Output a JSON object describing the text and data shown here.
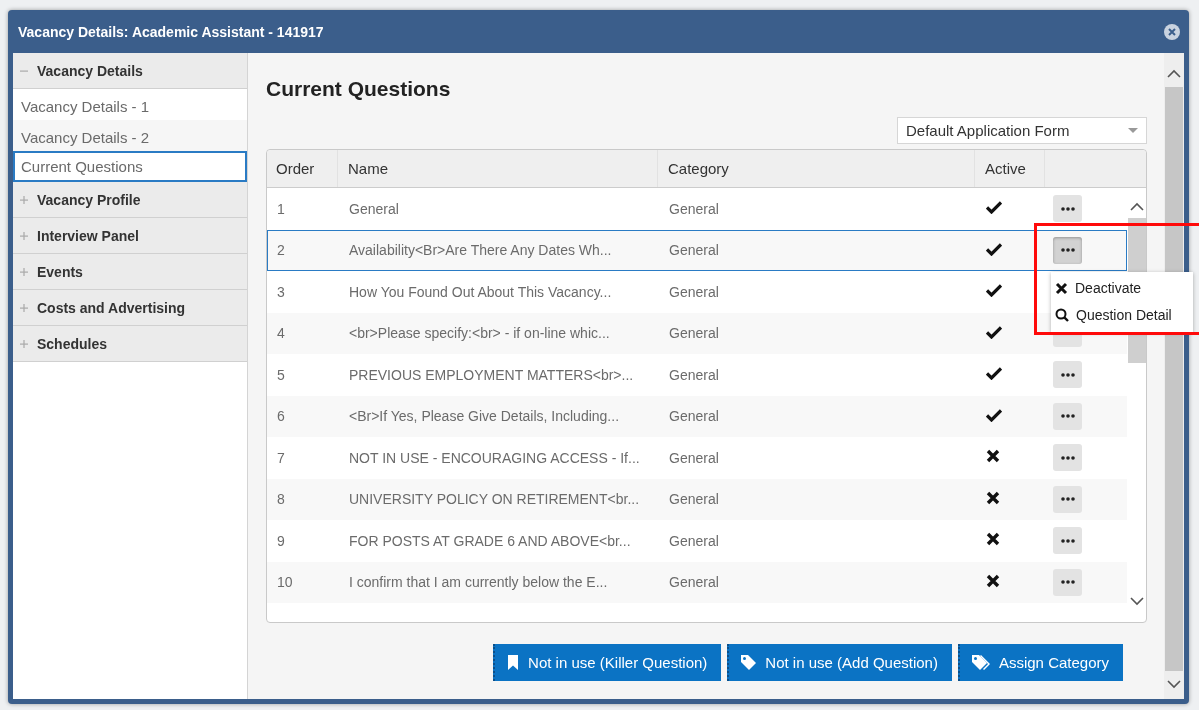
{
  "window": {
    "title": "Vacancy Details: Academic Assistant - 141917"
  },
  "sidebar": {
    "sections": [
      {
        "label": "Vacancy Details",
        "expanded": true,
        "children": [
          {
            "label": "Vacancy Details - 1",
            "selected": false
          },
          {
            "label": "Vacancy Details - 2",
            "selected": false
          },
          {
            "label": "Current Questions",
            "selected": true
          }
        ]
      },
      {
        "label": "Vacancy Profile",
        "expanded": false
      },
      {
        "label": "Interview Panel",
        "expanded": false
      },
      {
        "label": "Events",
        "expanded": false
      },
      {
        "label": "Costs and Advertising",
        "expanded": false
      },
      {
        "label": "Schedules",
        "expanded": false
      }
    ]
  },
  "heading": "Current Questions",
  "form_select": {
    "value": "Default Application Form"
  },
  "table": {
    "columns": [
      "Order",
      "Name",
      "Category",
      "Active"
    ],
    "rows": [
      {
        "order": "1",
        "name": "General",
        "category": "General",
        "active": true,
        "selected": false,
        "menu_open": false
      },
      {
        "order": "2",
        "name": "Availability<Br>Are There Any Dates Wh...",
        "category": "General",
        "active": true,
        "selected": true,
        "menu_open": true
      },
      {
        "order": "3",
        "name": "How You Found Out About This Vacancy...",
        "category": "General",
        "active": true,
        "selected": false,
        "menu_open": false
      },
      {
        "order": "4",
        "name": "<br>Please specify:<br> - if on-line whic...",
        "category": "General",
        "active": true,
        "selected": false,
        "menu_open": false
      },
      {
        "order": "5",
        "name": "PREVIOUS EMPLOYMENT MATTERS<br>...",
        "category": "General",
        "active": true,
        "selected": false,
        "menu_open": false
      },
      {
        "order": "6",
        "name": "<Br>If Yes, Please Give Details, Including...",
        "category": "General",
        "active": true,
        "selected": false,
        "menu_open": false
      },
      {
        "order": "7",
        "name": "NOT IN USE - ENCOURAGING ACCESS - If...",
        "category": "General",
        "active": false,
        "selected": false,
        "menu_open": false
      },
      {
        "order": "8",
        "name": "UNIVERSITY POLICY ON RETIREMENT<br...",
        "category": "General",
        "active": false,
        "selected": false,
        "menu_open": false
      },
      {
        "order": "9",
        "name": "FOR POSTS AT GRADE 6 AND ABOVE<br...",
        "category": "General",
        "active": false,
        "selected": false,
        "menu_open": false
      },
      {
        "order": "10",
        "name": "I confirm that I am currently below the E...",
        "category": "General",
        "active": false,
        "selected": false,
        "menu_open": false
      }
    ],
    "row_menu": [
      {
        "kind": "deactivate",
        "label": "Deactivate"
      },
      {
        "kind": "detail",
        "label": "Question Detail"
      }
    ]
  },
  "buttons": [
    {
      "kind": "bookmark",
      "label": "Not in use (Killer Question)"
    },
    {
      "kind": "tag",
      "label": "Not in use (Add Question)"
    },
    {
      "kind": "tags",
      "label": "Assign Category"
    }
  ]
}
